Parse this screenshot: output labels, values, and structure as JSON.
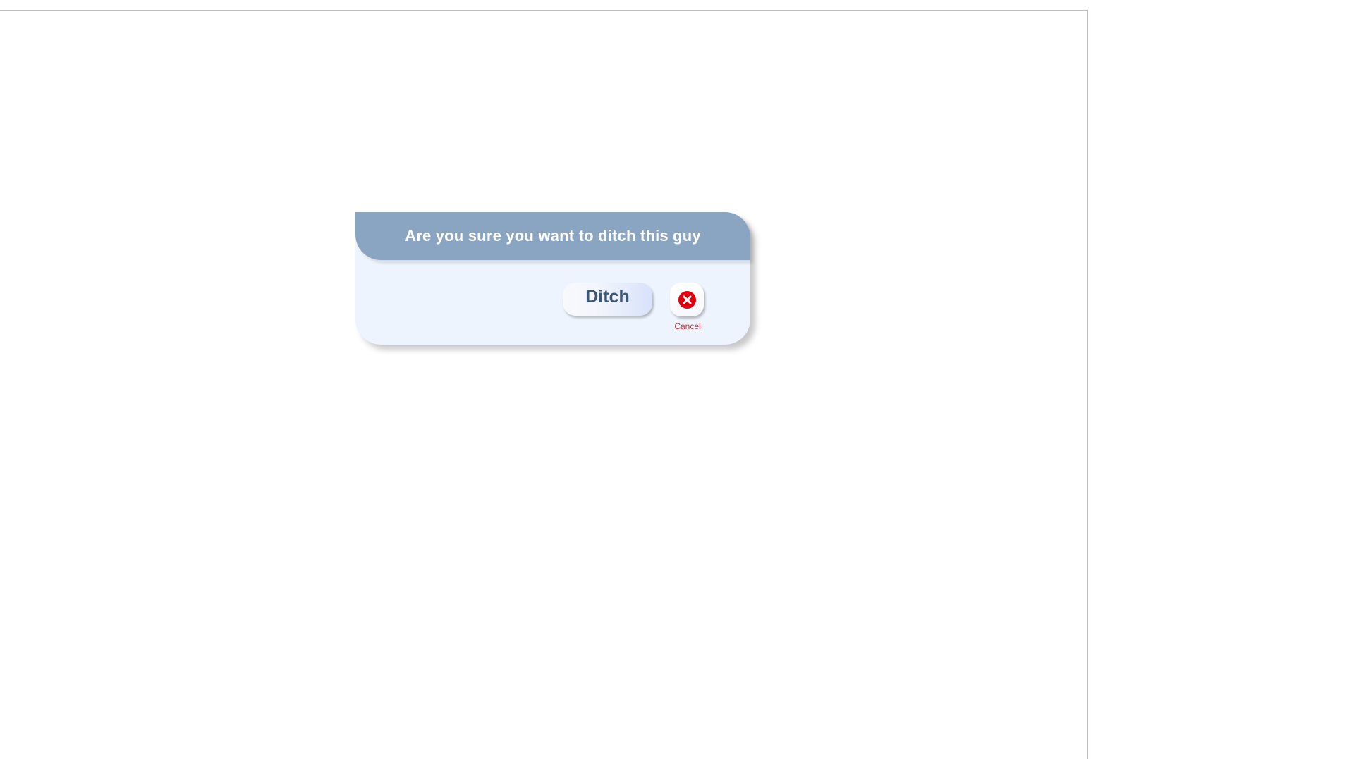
{
  "dialog": {
    "title": "Are you sure you want to ditch this guy",
    "ditch_button": {
      "label": "Ditch"
    },
    "cancel_button": {
      "label": "Cancel",
      "icon": "cancel-x-icon"
    }
  },
  "colors": {
    "header_background": "#8aa5c2",
    "dialog_background": "#eef4fd",
    "ditch_text": "#3b5879",
    "cancel_icon": "#e0000d",
    "cancel_text": "#d8262d"
  }
}
